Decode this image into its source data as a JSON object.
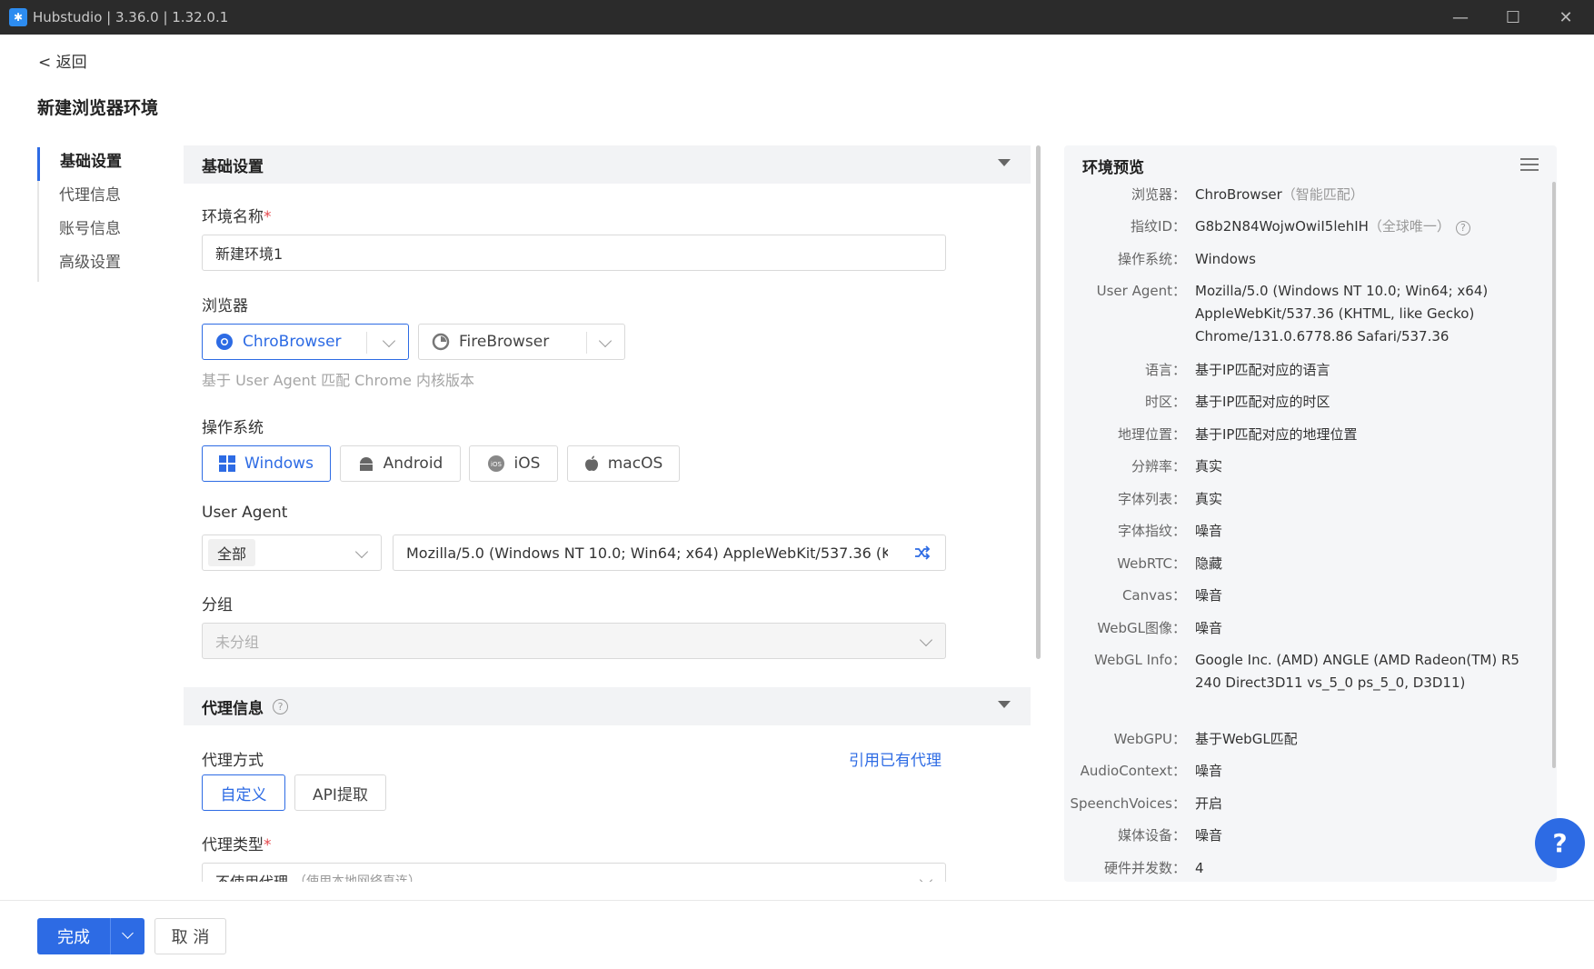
{
  "window": {
    "title": "Hubstudio | 3.36.0 | 1.32.0.1",
    "minimize_icon": "minimize-icon",
    "maximize_icon": "maximize-icon",
    "close_icon": "close-icon"
  },
  "header": {
    "back": "< 返回",
    "title": "新建浏览器环境"
  },
  "sidenav": {
    "items": [
      {
        "label": "基础设置",
        "active": true
      },
      {
        "label": "代理信息",
        "active": false
      },
      {
        "label": "账号信息",
        "active": false
      },
      {
        "label": "高级设置",
        "active": false
      }
    ]
  },
  "basic": {
    "section_title": "基础设置",
    "env_name_label": "环境名称",
    "required_mark": "*",
    "env_name_value": "新建环境1",
    "browser_label": "浏览器",
    "browser_options": [
      "ChroBrowser",
      "FireBrowser"
    ],
    "browser_selected": "ChroBrowser",
    "browser_hint": "基于 User Agent 匹配 Chrome 内核版本",
    "os_label": "操作系统",
    "os_options": [
      "Windows",
      "Android",
      "iOS",
      "macOS"
    ],
    "os_selected": "Windows",
    "ua_label": "User Agent",
    "ua_filter": "全部",
    "ua_value": "Mozilla/5.0 (Windows NT 10.0; Win64; x64) AppleWebKit/537.36 (KHTML, like Gecko) Chrome/131.0.6778.86 Safari/537.36",
    "group_label": "分组",
    "group_placeholder": "未分组"
  },
  "proxy": {
    "section_title": "代理信息",
    "method_label": "代理方式",
    "use_existing_link": "引用已有代理",
    "method_options": [
      "自定义",
      "API提取"
    ],
    "method_selected": "自定义",
    "type_label": "代理类型",
    "type_value": "不使用代理",
    "type_note": "（使用本地网络直连）"
  },
  "preview": {
    "title": "环境预览",
    "rows": [
      {
        "key": "浏览器：",
        "value": "ChroBrowser",
        "note": "（智能匹配）"
      },
      {
        "key": "指纹ID：",
        "value": "G8b2N84WojwOwiI5lehIH",
        "note": "（全球唯一）"
      },
      {
        "key": "操作系统：",
        "value": "Windows"
      },
      {
        "key": "User Agent：",
        "value": "Mozilla/5.0 (Windows NT 10.0; Win64; x64) AppleWebKit/537.36 (KHTML, like Gecko) Chrome/131.0.6778.86 Safari/537.36"
      },
      {
        "key": "语言：",
        "value": "基于IP匹配对应的语言"
      },
      {
        "key": "时区：",
        "value": "基于IP匹配对应的时区"
      },
      {
        "key": "地理位置：",
        "value": "基于IP匹配对应的地理位置"
      },
      {
        "key": "分辨率：",
        "value": "真实"
      },
      {
        "key": "字体列表：",
        "value": "真实"
      },
      {
        "key": "字体指纹：",
        "value": "噪音"
      },
      {
        "key": "WebRTC：",
        "value": "隐藏"
      },
      {
        "key": "Canvas：",
        "value": "噪音"
      },
      {
        "key": "WebGL图像：",
        "value": "噪音"
      },
      {
        "key": "WebGL Info：",
        "value": "Google Inc. (AMD) ANGLE (AMD Radeon(TM) R5 240 Direct3D11 vs_5_0 ps_5_0, D3D11)"
      },
      {
        "key": "WebGPU：",
        "value": "基于WebGL匹配"
      },
      {
        "key": "AudioContext：",
        "value": "噪音"
      },
      {
        "key": "SpeenchVoices：",
        "value": "开启"
      },
      {
        "key": "媒体设备：",
        "value": "噪音"
      },
      {
        "key": "硬件并发数：",
        "value": "4"
      }
    ]
  },
  "footer": {
    "done": "完成",
    "cancel": "取 消"
  },
  "help_fab": "?",
  "colors": {
    "accent": "#2d6be4",
    "titlebar": "#2b2b2b"
  }
}
